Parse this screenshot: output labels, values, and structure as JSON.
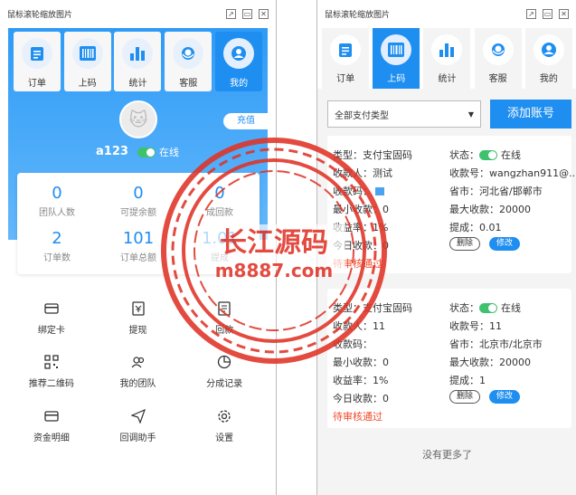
{
  "left_window": {
    "title": "鼠标滚轮缩放图片",
    "tabs": [
      {
        "label": "订单",
        "icon": "clipboard-icon",
        "active": false
      },
      {
        "label": "上码",
        "icon": "barcode-icon",
        "active": false
      },
      {
        "label": "统计",
        "icon": "bar-chart-icon",
        "active": false
      },
      {
        "label": "客服",
        "icon": "headset-icon",
        "active": false
      },
      {
        "label": "我的",
        "icon": "user-icon",
        "active": true
      }
    ],
    "recharge_label": "充值",
    "username": "a123",
    "online_label": "在线",
    "stats": [
      {
        "value": "0",
        "label": "团队人数"
      },
      {
        "value": "0",
        "label": "可提余额"
      },
      {
        "value": "0",
        "label": "成回款"
      },
      {
        "value": "2",
        "label": "订单数"
      },
      {
        "value": "101",
        "label": "订单总额"
      },
      {
        "value": "1.01",
        "label": "提成"
      }
    ],
    "menu": [
      {
        "label": "绑定卡",
        "icon": "card-icon"
      },
      {
        "label": "提现",
        "icon": "withdraw-icon"
      },
      {
        "label": "回款",
        "icon": "refund-icon"
      },
      {
        "label": "推荐二维码",
        "icon": "qrcode-icon"
      },
      {
        "label": "我的团队",
        "icon": "team-icon"
      },
      {
        "label": "分成记录",
        "icon": "pie-chart-icon"
      },
      {
        "label": "资金明细",
        "icon": "wallet-icon"
      },
      {
        "label": "回调助手",
        "icon": "send-icon"
      },
      {
        "label": "设置",
        "icon": "gear-icon"
      }
    ]
  },
  "right_window": {
    "title": "鼠标滚轮缩放图片",
    "tabs": [
      {
        "label": "订单",
        "icon": "clipboard-icon",
        "active": false
      },
      {
        "label": "上码",
        "icon": "barcode-icon",
        "active": true
      },
      {
        "label": "统计",
        "icon": "bar-chart-icon",
        "active": false
      },
      {
        "label": "客服",
        "icon": "headset-icon",
        "active": false
      },
      {
        "label": "我的",
        "icon": "user-icon",
        "active": false
      }
    ],
    "filter_value": "全部支付类型",
    "add_button": "添加账号",
    "cards": [
      {
        "type": "类型：支付宝固码",
        "status_prefix": "状态：",
        "status": "在线",
        "payee": "收款人：测试",
        "account": "收款号：wangzhan911@...",
        "qrcode": "收款码：",
        "province": "省市：河北省/邯郸市",
        "min": "最小收款：0",
        "max": "最大收款：20000",
        "rate": "收益率：1%",
        "commission": "提成：0.01",
        "today": "今日收款：0",
        "audit": "待审核通过",
        "delete_label": "删除",
        "edit_label": "修改"
      },
      {
        "type": "类型：支付宝固码",
        "status_prefix": "状态：",
        "status": "在线",
        "payee": "收款人：11",
        "account": "收款号：11",
        "qrcode": "收款码：",
        "province": "省市：北京市/北京市",
        "min": "最小收款：0",
        "max": "最大收款：20000",
        "rate": "收益率：1%",
        "commission": "提成：1",
        "today": "今日收款：0",
        "audit": "待审核通过",
        "delete_label": "删除",
        "edit_label": "修改"
      }
    ],
    "no_more": "没有更多了"
  },
  "watermark": {
    "line1": "长江源码",
    "line2": "m8887.com",
    "color": "#e03326"
  },
  "colors": {
    "primary": "#1e8ef0",
    "online": "#3ec26e",
    "pending": "#f04a2b"
  }
}
